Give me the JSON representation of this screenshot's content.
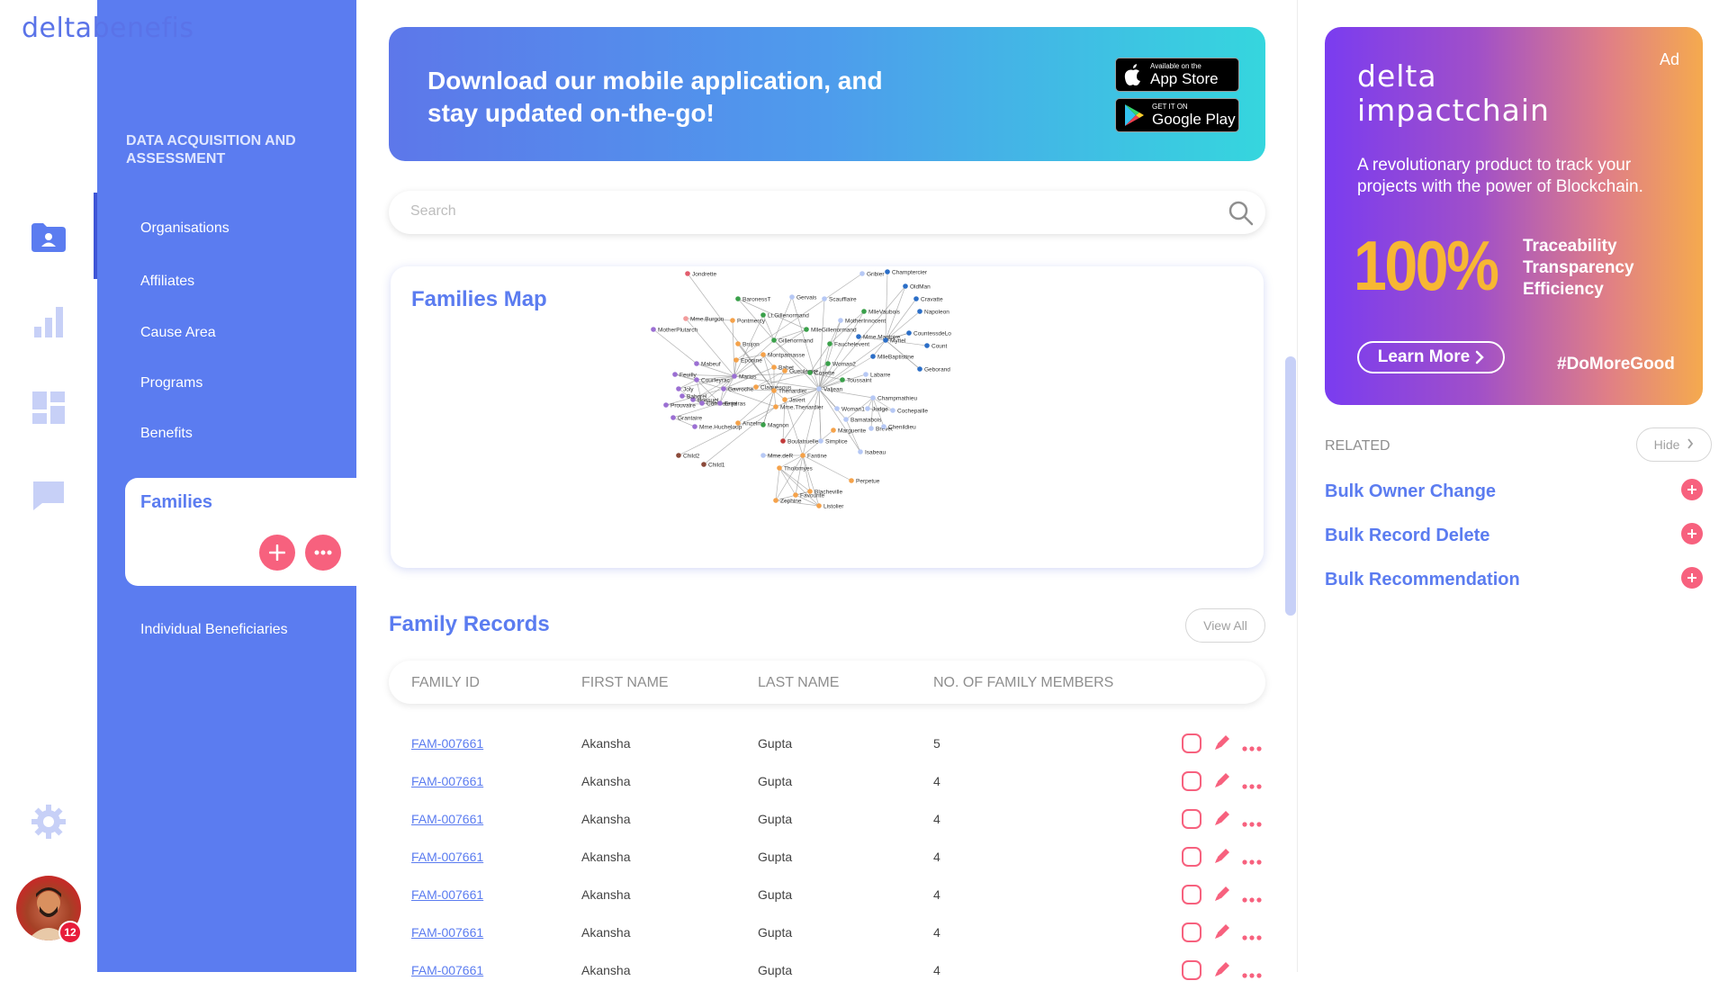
{
  "app": {
    "logo_part1": "delta",
    "logo_part2": "benefis"
  },
  "sidebar": {
    "section_title": "DATA ACQUISITION AND ASSESSMENT",
    "items": [
      {
        "label": "Organisations"
      },
      {
        "label": "Affiliates"
      },
      {
        "label": "Cause Area"
      },
      {
        "label": "Programs"
      },
      {
        "label": "Benefits"
      },
      {
        "label": "Families"
      },
      {
        "label": "Individual Beneficiaries"
      }
    ],
    "active_item": "Families"
  },
  "rail": {
    "icons": [
      "folder-user-icon",
      "bar-chart-icon",
      "dashboard-icon",
      "chat-icon",
      "settings-icon"
    ],
    "notification_count": "12"
  },
  "banner": {
    "text": "Download our mobile application, and stay updated on-the-go!",
    "app_store_small": "Available on the",
    "app_store_big": "App Store",
    "google_play_small": "GET IT ON",
    "google_play_big": "Google Play"
  },
  "search": {
    "placeholder": "Search"
  },
  "families_map": {
    "title": "Families Map",
    "nodes": [
      {
        "label": "Jondrette",
        "color": "#e25c6c"
      },
      {
        "label": "Gribier",
        "color": "#b6c8f5"
      },
      {
        "label": "Champtercier",
        "color": "#2b6ec7"
      },
      {
        "label": "OldMan",
        "color": "#2b6ec7"
      },
      {
        "label": "Cravatte",
        "color": "#2b6ec7"
      },
      {
        "label": "BaronessT",
        "color": "#3aa04a"
      },
      {
        "label": "Gervais",
        "color": "#b6c8f5"
      },
      {
        "label": "Scaufflaire",
        "color": "#b6c8f5"
      },
      {
        "label": "MlleVaubois",
        "color": "#3aa04a"
      },
      {
        "label": "Napoleon",
        "color": "#2b6ec7"
      },
      {
        "label": "Mme.Burgon",
        "color": "#f29b9b"
      },
      {
        "label": "Pontmercy",
        "color": "#f5a24a"
      },
      {
        "label": "Lt.Gillenormand",
        "color": "#3aa04a"
      },
      {
        "label": "MotherInnocent",
        "color": "#b6c8f5"
      },
      {
        "label": "MotherPlutarch",
        "color": "#9b6fd3"
      },
      {
        "label": "MlleGillenormand",
        "color": "#3aa04a"
      },
      {
        "label": "CountessdeLo",
        "color": "#2b6ec7"
      },
      {
        "label": "Gillenormand",
        "color": "#3aa04a"
      },
      {
        "label": "Mme.Magloire",
        "color": "#2b6ec7"
      },
      {
        "label": "Myriel",
        "color": "#2b6ec7"
      },
      {
        "label": "Brujon",
        "color": "#f5a24a"
      },
      {
        "label": "Fauchelevent",
        "color": "#3aa04a"
      },
      {
        "label": "Count",
        "color": "#2b6ec7"
      },
      {
        "label": "Montparnasse",
        "color": "#f5a24a"
      },
      {
        "label": "Eponine",
        "color": "#f5a24a"
      },
      {
        "label": "MlleBaptistine",
        "color": "#2b6ec7"
      },
      {
        "label": "Mabeuf",
        "color": "#9b6fd3"
      },
      {
        "label": "Babet",
        "color": "#f5a24a"
      },
      {
        "label": "Woman2",
        "color": "#3aa04a"
      },
      {
        "label": "Geborand",
        "color": "#2b6ec7"
      },
      {
        "label": "Feuilly",
        "color": "#9b6fd3"
      },
      {
        "label": "Marius",
        "color": "#9b6fd3"
      },
      {
        "label": "Gueulemer",
        "color": "#f5a24a"
      },
      {
        "label": "Cosette",
        "color": "#3aa04a"
      },
      {
        "label": "Labarre",
        "color": "#b6c8f5"
      },
      {
        "label": "Courfeyrac",
        "color": "#9b6fd3"
      },
      {
        "label": "Toussaint",
        "color": "#3aa04a"
      },
      {
        "label": "Joly",
        "color": "#9b6fd3"
      },
      {
        "label": "Gavroche",
        "color": "#9b6fd3"
      },
      {
        "label": "Claquesous",
        "color": "#f5a24a"
      },
      {
        "label": "Thenardier",
        "color": "#f5a24a"
      },
      {
        "label": "Valjean",
        "color": "#b6c8f5"
      },
      {
        "label": "Bossuet",
        "color": "#9b6fd3"
      },
      {
        "label": "Champmathieu",
        "color": "#b6c8f5"
      },
      {
        "label": "Combeferre",
        "color": "#9b6fd3"
      },
      {
        "label": "Enjolras",
        "color": "#9b6fd3"
      },
      {
        "label": "Bahorel",
        "color": "#9b6fd3"
      },
      {
        "label": "Prouvaire",
        "color": "#9b6fd3"
      },
      {
        "label": "Javert",
        "color": "#f5a24a"
      },
      {
        "label": "Mme.Thenardier",
        "color": "#f5a24a"
      },
      {
        "label": "Judge",
        "color": "#b6c8f5"
      },
      {
        "label": "Cochepaille",
        "color": "#b6c8f5"
      },
      {
        "label": "Woman1",
        "color": "#b6c8f5"
      },
      {
        "label": "Grantaire",
        "color": "#9b6fd3"
      },
      {
        "label": "Bamatabois",
        "color": "#b6c8f5"
      },
      {
        "label": "Mme.Hucheloup",
        "color": "#9b6fd3"
      },
      {
        "label": "Anzelma",
        "color": "#f5a24a"
      },
      {
        "label": "Magnon",
        "color": "#3aa04a"
      },
      {
        "label": "Marguerite",
        "color": "#f5a24a"
      },
      {
        "label": "Brevet",
        "color": "#b6c8f5"
      },
      {
        "label": "Chenildieu",
        "color": "#b6c8f5"
      },
      {
        "label": "Boulatruelle",
        "color": "#c23a3a"
      },
      {
        "label": "Simplice",
        "color": "#b6c8f5"
      },
      {
        "label": "Isabeau",
        "color": "#b6c8f5"
      },
      {
        "label": "Child2",
        "color": "#8b4a3a"
      },
      {
        "label": "Mme.deR",
        "color": "#b6c8f5"
      },
      {
        "label": "Fantine",
        "color": "#f5a24a"
      },
      {
        "label": "Child1",
        "color": "#8b4a3a"
      },
      {
        "label": "Tholomyes",
        "color": "#f5a24a"
      },
      {
        "label": "Perpetue",
        "color": "#f5a24a"
      },
      {
        "label": "Blacheville",
        "color": "#f5a24a"
      },
      {
        "label": "Favourite",
        "color": "#f5a24a"
      },
      {
        "label": "Zephine",
        "color": "#f5a24a"
      },
      {
        "label": "Listolier",
        "color": "#f5a24a"
      }
    ]
  },
  "records": {
    "title": "Family Records",
    "view_all": "View All",
    "columns": [
      "FAMILY ID",
      "FIRST NAME",
      "LAST NAME",
      "NO. OF FAMILY MEMBERS"
    ],
    "rows": [
      {
        "id": "FAM-007661",
        "first": "Akansha",
        "last": "Gupta",
        "members": "5"
      },
      {
        "id": "FAM-007661",
        "first": "Akansha",
        "last": "Gupta",
        "members": "4"
      },
      {
        "id": "FAM-007661",
        "first": "Akansha",
        "last": "Gupta",
        "members": "4"
      },
      {
        "id": "FAM-007661",
        "first": "Akansha",
        "last": "Gupta",
        "members": "4"
      },
      {
        "id": "FAM-007661",
        "first": "Akansha",
        "last": "Gupta",
        "members": "4"
      },
      {
        "id": "FAM-007661",
        "first": "Akansha",
        "last": "Gupta",
        "members": "4"
      },
      {
        "id": "FAM-007661",
        "first": "Akansha",
        "last": "Gupta",
        "members": "4"
      }
    ]
  },
  "ad": {
    "label": "Ad",
    "brand_line1": "delta",
    "brand_line2": "impactchain",
    "description": "A revolutionary product to track your projects with the power of Blockchain.",
    "percent": "100%",
    "features": [
      "Traceability",
      "Transparency",
      "Efficiency"
    ],
    "cta": "Learn More",
    "hashtag": "#DoMoreGood"
  },
  "related": {
    "label": "RELATED",
    "hide": "Hide",
    "items": [
      "Bulk Owner Change",
      "Bulk Record Delete",
      "Bulk Recommendation"
    ]
  },
  "colors": {
    "primary": "#5b7cf0",
    "accent_pink": "#f7617e",
    "ad_orange": "#f7b733"
  }
}
